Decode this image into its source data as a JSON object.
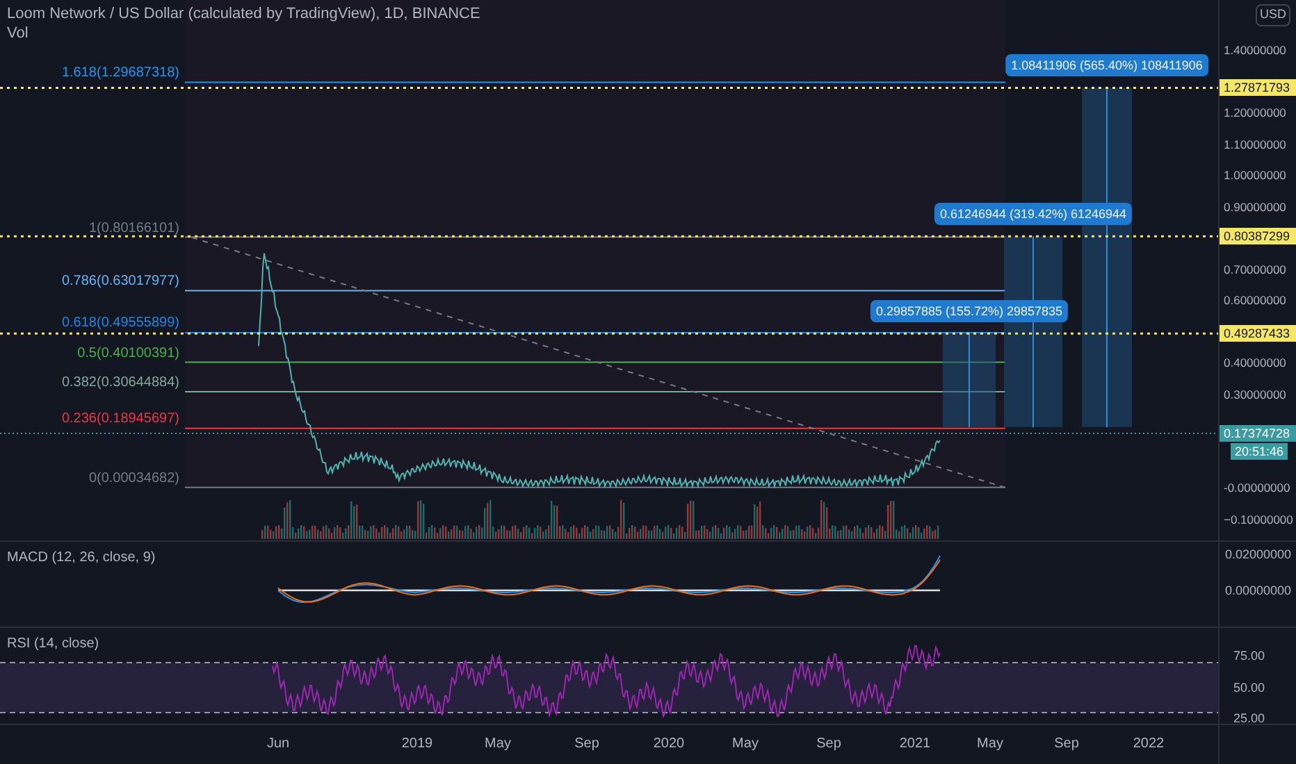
{
  "header": {
    "title": "Loom Network / US Dollar (calculated by TradingView), 1D, BINANCE",
    "volume_label": "Vol"
  },
  "currency": "USD",
  "fib_levels": [
    {
      "label": "1.618(1.29687318)",
      "color": "#2196f3"
    },
    {
      "label": "1(0.80166101)",
      "color": "#787b86"
    },
    {
      "label": "0.786(0.63017977)",
      "color": "#64b5f6"
    },
    {
      "label": "0.618(0.49555899)",
      "color": "#1e88e5"
    },
    {
      "label": "0.5(0.40100391)",
      "color": "#4caf50"
    },
    {
      "label": "0.382(0.30644884)",
      "color": "#81a99a"
    },
    {
      "label": "0.236(0.18945697)",
      "color": "#f23645"
    },
    {
      "label": "0(0.00034682)",
      "color": "#787b86"
    }
  ],
  "projections": [
    {
      "label": "0.29857885 (155.72%) 29857835"
    },
    {
      "label": "0.61246944 (319.42%) 61246944"
    },
    {
      "label": "1.08411906 (565.40%) 108411906"
    }
  ],
  "price_tags": [
    "1.27871793",
    "0.80387299",
    "0.49287433"
  ],
  "last_price": {
    "price": "0.17374728",
    "countdown": "20:51:46"
  },
  "price_axis": [
    "1.40000000",
    "1.20000000",
    "1.10000000",
    "1.00000000",
    "0.90000000",
    "0.70000000",
    "0.60000000",
    "0.40000000",
    "0.30000000",
    "-0.00000000",
    "−0.10000000"
  ],
  "macd": {
    "title": "MACD (12, 26, close, 9)",
    "axis": [
      "0.02000000",
      "0.00000000"
    ]
  },
  "rsi": {
    "title": "RSI (14, close)",
    "axis": [
      "75.00",
      "50.00",
      "25.00"
    ]
  },
  "time_axis": [
    "Jun",
    "2019",
    "May",
    "Sep",
    "2020",
    "May",
    "Sep",
    "2021",
    "May",
    "Sep",
    "2022"
  ]
}
